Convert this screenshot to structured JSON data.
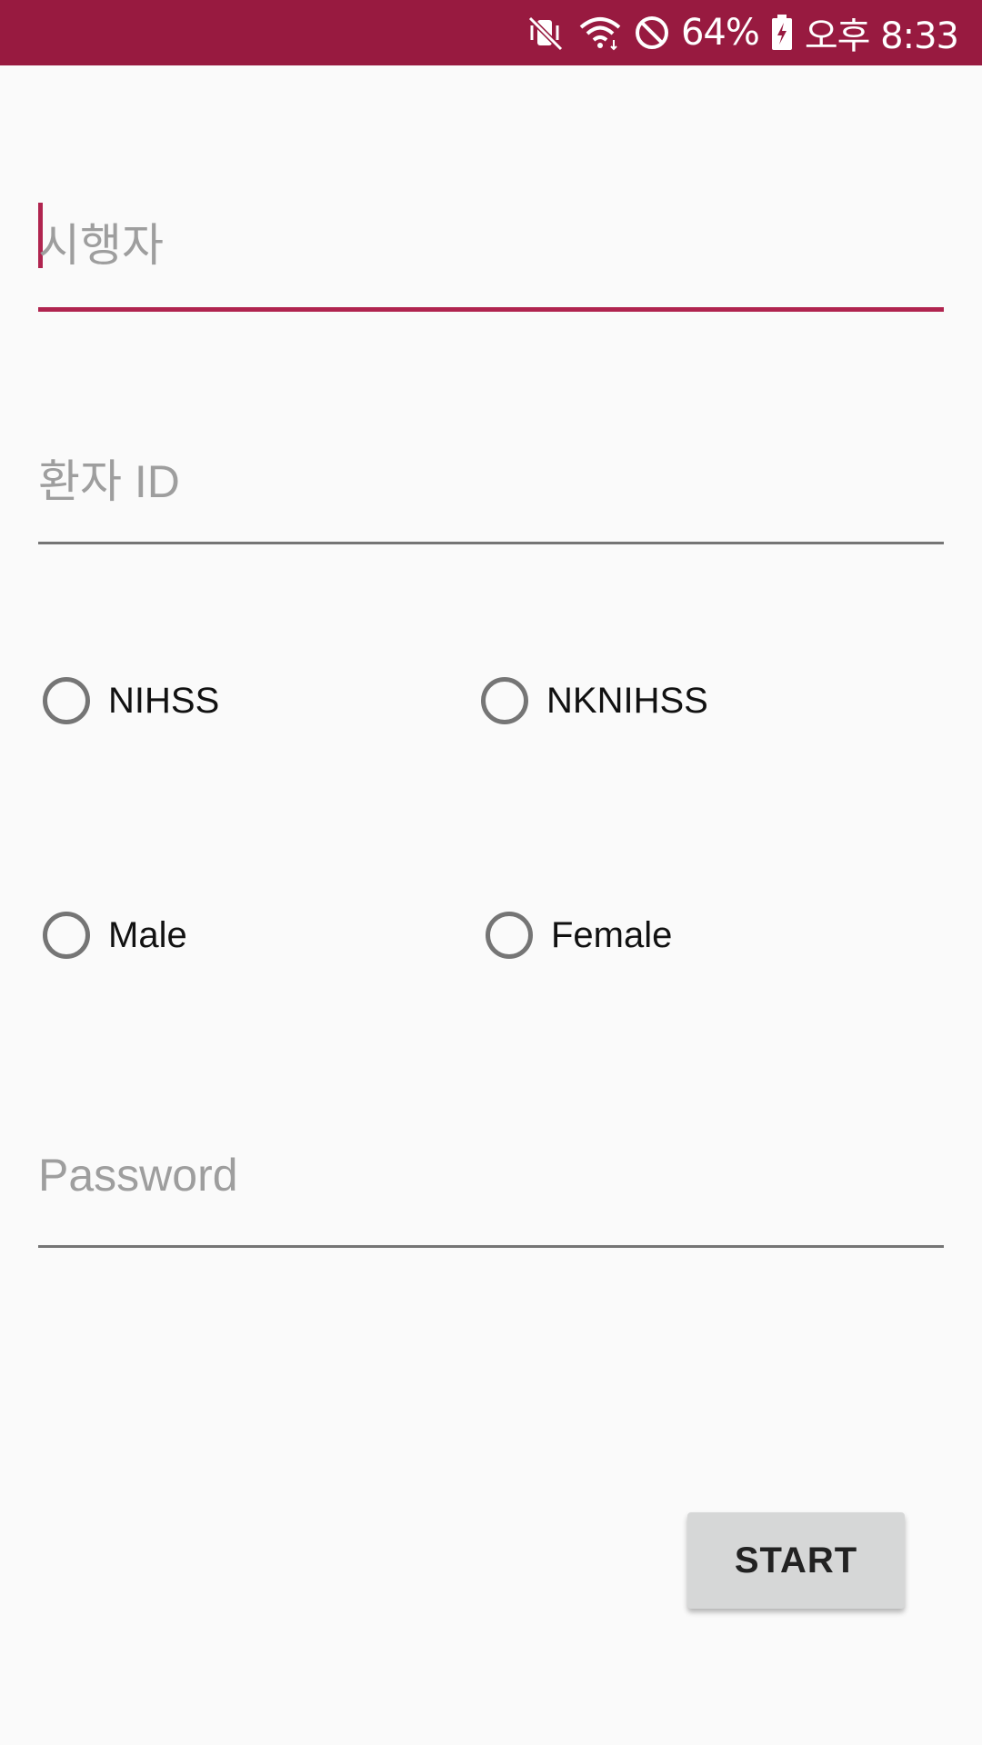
{
  "status_bar": {
    "background": "#981a40",
    "icons": [
      "vibrate-mute-icon",
      "wifi-icon",
      "blocked-icon",
      "battery-charging-icon"
    ],
    "battery_percent": "64%",
    "time": "오후 8:33"
  },
  "form": {
    "examiner_placeholder": "시행자",
    "patient_id_placeholder": "환자 ID",
    "scale_options": [
      {
        "label": "NIHSS",
        "checked": false
      },
      {
        "label": "NKNIHSS",
        "checked": false
      }
    ],
    "sex_options": [
      {
        "label": "Male",
        "checked": false
      },
      {
        "label": "Female",
        "checked": false
      }
    ],
    "password_placeholder": "Password",
    "start_label": "START"
  },
  "colors": {
    "accent": "#b0244f",
    "underline": "#757575",
    "background": "#fafafa",
    "button": "#d6d7d7"
  }
}
